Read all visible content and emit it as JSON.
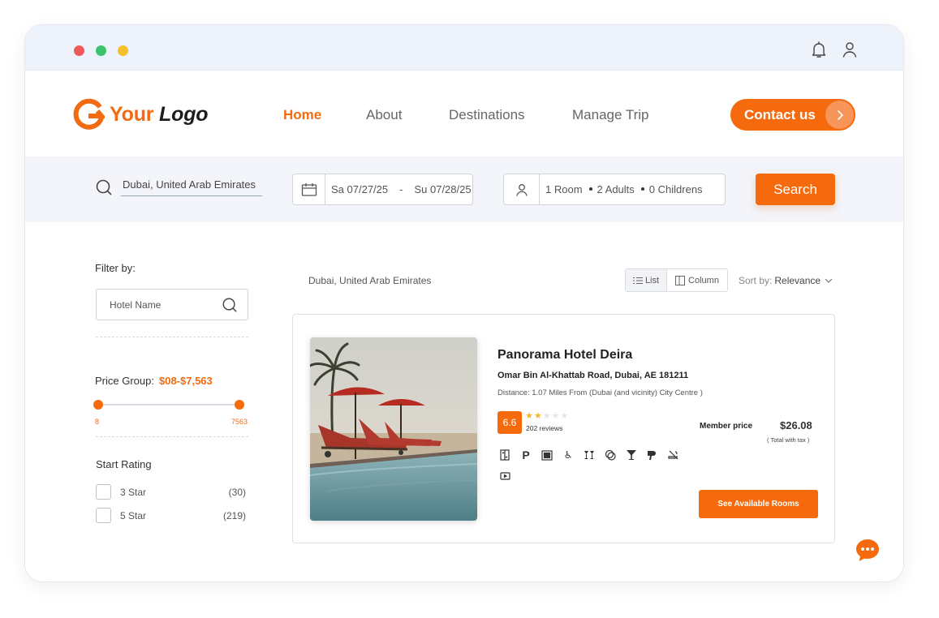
{
  "brand": {
    "logo_part1": "Your",
    "logo_part2": "Logo"
  },
  "nav": {
    "items": [
      {
        "label": "Home",
        "active": true
      },
      {
        "label": "About"
      },
      {
        "label": "Destinations"
      },
      {
        "label": "Manage Trip"
      }
    ],
    "contact_label": "Contact us"
  },
  "search": {
    "location": "Dubai, United Arab Emirates",
    "check_in": "Sa 07/27/25",
    "date_sep": "-",
    "check_out": "Su 07/28/25",
    "rooms": "1 Room",
    "adults": "2 Adults",
    "children": "0 Childrens",
    "button_label": "Search"
  },
  "filters": {
    "title": "Filter by:",
    "hotel_name_placeholder": "Hotel Name",
    "price_label": "Price Group:",
    "price_value": "$08-$7,563",
    "price_min": "8",
    "price_max": "7563",
    "rating_title": "Start Rating",
    "ratings": [
      {
        "label": "3 Star",
        "count": "(30)"
      },
      {
        "label": "5 Star",
        "count": "(219)"
      }
    ]
  },
  "results": {
    "location_label": "Dubai, United Arab Emirates",
    "view_list": "List",
    "view_column": "Column",
    "sort_label": "Sort by:",
    "sort_value": "Relevance"
  },
  "hotel": {
    "name": "Panorama Hotel Deira",
    "address": "Omar Bin Al-Khattab Road, Dubai, AE 181211",
    "distance": "Distance: 1.07 Miles From (Dubai (and vicinity) City Centre )",
    "score": "6.6",
    "stars": 2,
    "reviews": "202 reviews",
    "member_label": "Member price",
    "price": "$26.08",
    "tax_note": "( Total with tax )",
    "button_label": "See Available Rooms",
    "amenities": [
      "lift-icon",
      "parking-icon",
      "safe-icon",
      "accessible-icon",
      "bar-icon",
      "laundry-icon",
      "cocktail-icon",
      "hairdryer-icon",
      "no-smoking-icon",
      "tv-icon"
    ]
  },
  "colors": {
    "accent": "#f56a0d",
    "accent_text": "#f26b12",
    "titlebar": "#eef2fa"
  }
}
